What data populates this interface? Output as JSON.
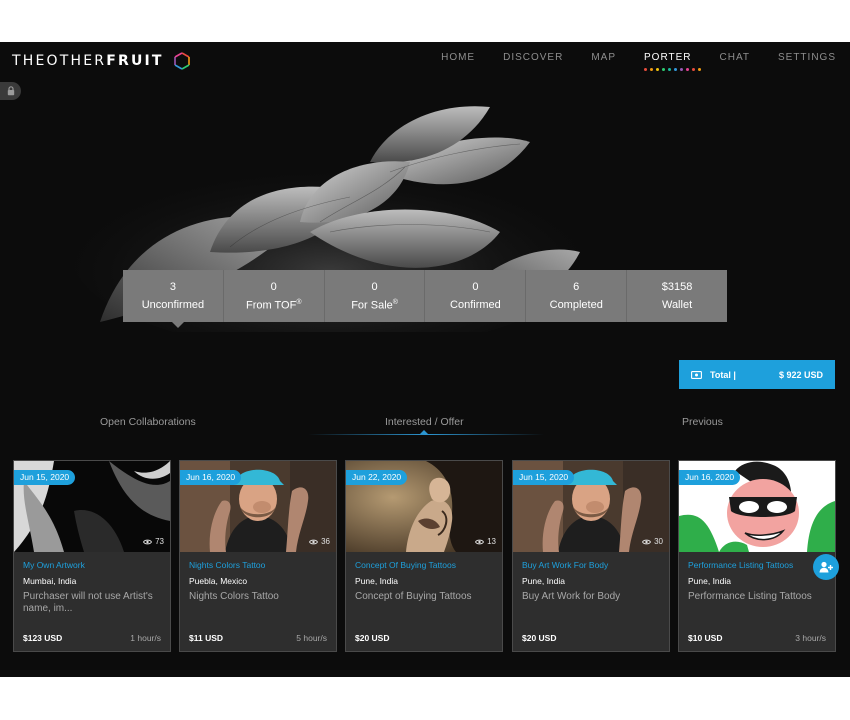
{
  "brand": {
    "name_light": "THEOTHER",
    "name_bold": "FRUIT"
  },
  "nav": {
    "items": [
      {
        "label": "HOME"
      },
      {
        "label": "DISCOVER"
      },
      {
        "label": "MAP"
      },
      {
        "label": "PORTER"
      },
      {
        "label": "CHAT"
      },
      {
        "label": "SETTINGS"
      }
    ],
    "active": "PORTER",
    "dot_colors": [
      "#e84c3d",
      "#f39c12",
      "#f1c40f",
      "#2ecc71",
      "#1abc9c",
      "#3498db",
      "#9b59b6",
      "#e84393",
      "#e74c3c",
      "#f39c12"
    ]
  },
  "stats": [
    {
      "value": "3",
      "label": "Unconfirmed"
    },
    {
      "value": "0",
      "label": "From TOF",
      "sup": "®"
    },
    {
      "value": "0",
      "label": "For Sale",
      "sup": "®"
    },
    {
      "value": "0",
      "label": "Confirmed"
    },
    {
      "value": "6",
      "label": "Completed"
    },
    {
      "value": "$3158",
      "label": "Wallet"
    }
  ],
  "total": {
    "label": "Total |",
    "amount": "$ 922 USD"
  },
  "tabs": {
    "open": "Open Collaborations",
    "interested": "Interested / Offer",
    "previous": "Previous",
    "active": "interested"
  },
  "cards": [
    {
      "date": "Jun 15, 2020",
      "views": "73",
      "title": "My Own Artwork",
      "location": "Mumbai, India",
      "description": "Purchaser will not use Artist's name, im...",
      "price": "$123 USD",
      "time": "1 hour/s"
    },
    {
      "date": "Jun 16, 2020",
      "views": "36",
      "title": "Nights Colors Tattoo",
      "location": "Puebla, Mexico",
      "description": "Nights Colors Tattoo",
      "price": "$11 USD",
      "time": "5 hour/s"
    },
    {
      "date": "Jun 22, 2020",
      "views": "13",
      "title": "Concept Of Buying Tattoos",
      "location": "Pune, India",
      "description": "Concept of Buying Tattoos",
      "price": "$20 USD",
      "time": ""
    },
    {
      "date": "Jun 15, 2020",
      "views": "30",
      "title": "Buy Art Work For Body",
      "location": "Pune, India",
      "description": "Buy Art Work for Body",
      "price": "$20 USD",
      "time": ""
    },
    {
      "date": "Jun 16, 2020",
      "views": "",
      "title": "Performance Listing Tattoos",
      "location": "Pune, India",
      "description": "Performance Listing Tattoos",
      "price": "$10 USD",
      "time": "3 hour/s"
    }
  ],
  "colors": {
    "accent": "#1ea0dc",
    "stats_bg": "#7a7a7a",
    "card_bg": "#2e2e2e",
    "app_bg": "#0c0c0c"
  }
}
